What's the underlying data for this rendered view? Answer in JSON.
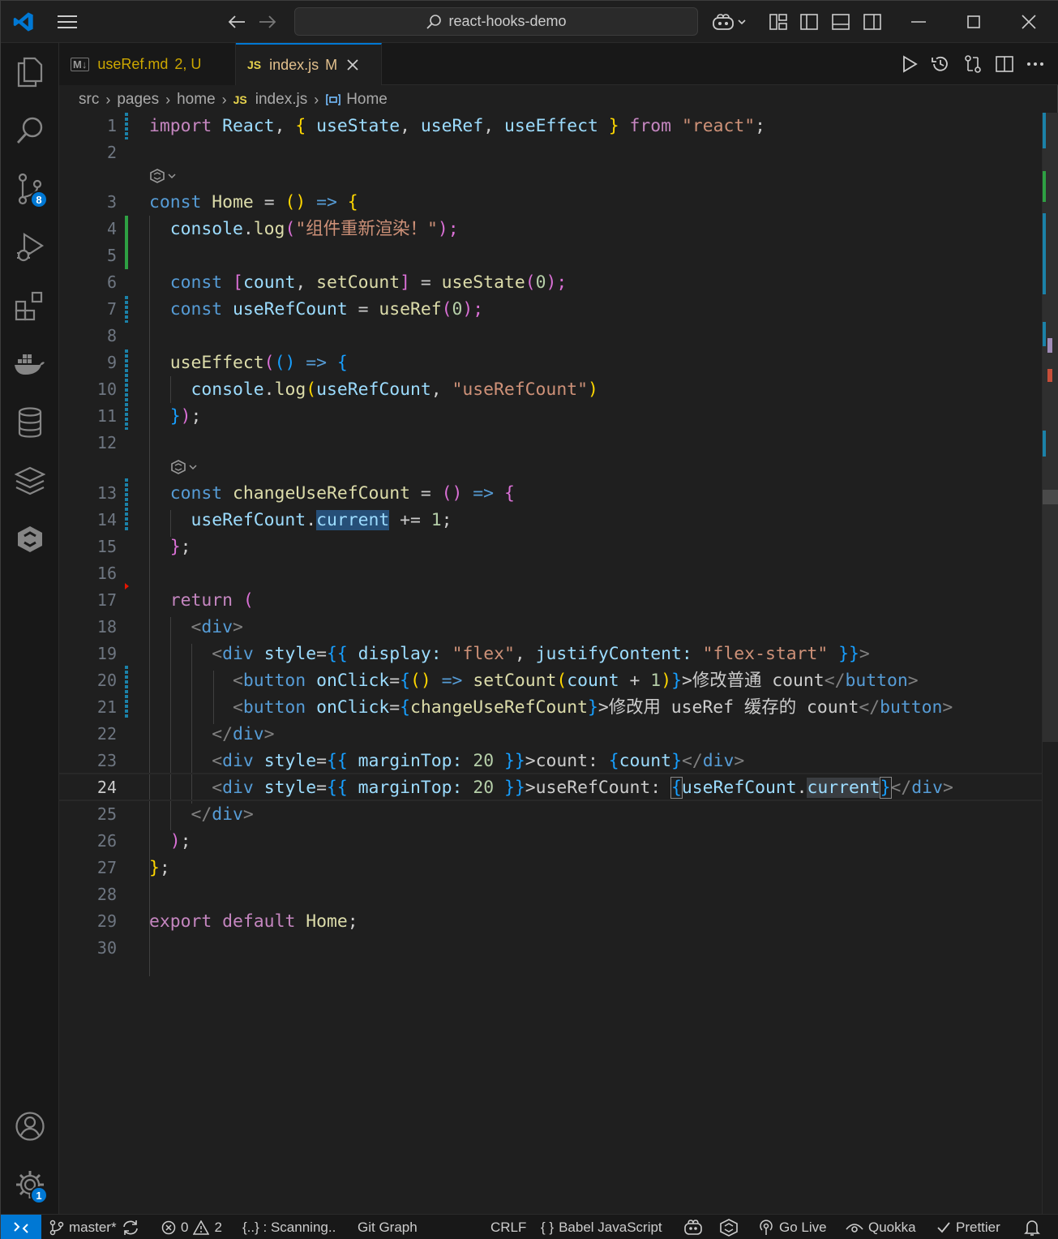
{
  "window": {
    "title": "react-hooks-demo"
  },
  "tabs": [
    {
      "icon": "M↓",
      "name": "useRef.md",
      "status": "2, U"
    },
    {
      "icon": "JS",
      "name": "index.js",
      "status": "M"
    }
  ],
  "breadcrumb": [
    "src",
    "pages",
    "home",
    "index.js",
    "Home"
  ],
  "breadcrumb_icons": {
    "js": "JS"
  },
  "activity": {
    "scm_badge": "8",
    "settings_badge": "1"
  },
  "line_numbers": [
    "1",
    "2",
    "3",
    "4",
    "5",
    "6",
    "7",
    "8",
    "9",
    "10",
    "11",
    "12",
    "13",
    "14",
    "15",
    "16",
    "17",
    "18",
    "19",
    "20",
    "21",
    "22",
    "23",
    "24",
    "25",
    "26",
    "27",
    "28",
    "29",
    "30"
  ],
  "code": {
    "l1": [
      "import",
      " ",
      "React",
      ", ",
      "{",
      " ",
      "useState",
      ", ",
      "useRef",
      ", ",
      "useEffect",
      " ",
      "}",
      " ",
      "from",
      " ",
      "\"react\"",
      ";"
    ],
    "l3": [
      "const",
      " ",
      "Home",
      " = ",
      "()",
      " ",
      "=>",
      " ",
      "{"
    ],
    "l4": [
      "  console",
      ".",
      "log",
      "(",
      "\"组件重新渲染！\"",
      ");"
    ],
    "l6": [
      "  const",
      " ",
      "[",
      "count",
      ", ",
      "setCount",
      "]",
      " = ",
      "useState",
      "(",
      "0",
      ");"
    ],
    "l7": [
      "  const",
      " ",
      "useRefCount",
      " = ",
      "useRef",
      "(",
      "0",
      ");"
    ],
    "l9": [
      "  useEffect",
      "(",
      "()",
      " ",
      "=>",
      " ",
      "{"
    ],
    "l10": [
      "    console",
      ".",
      "log",
      "(",
      "useRefCount",
      ", ",
      "\"useRefCount\"",
      ")"
    ],
    "l11": [
      "  ",
      "}",
      ")",
      ";"
    ],
    "l13": [
      "  const",
      " ",
      "changeUseRefCount",
      " = ",
      "()",
      " ",
      "=>",
      " ",
      "{"
    ],
    "l14": [
      "    useRefCount",
      ".",
      "current",
      " += ",
      "1",
      ";"
    ],
    "l15": [
      "  ",
      "}",
      ";"
    ],
    "l17": [
      "  return",
      " ",
      "("
    ],
    "l18": [
      "    <",
      "div",
      ">"
    ],
    "l19": [
      "      <",
      "div",
      " ",
      "style",
      "=",
      "{{",
      " ",
      "display",
      ": ",
      "\"flex\"",
      ", ",
      "justifyContent",
      ": ",
      "\"flex-start\"",
      " ",
      "}}",
      ">"
    ],
    "l20": [
      "        <",
      "button",
      " ",
      "onClick",
      "=",
      "{",
      "()",
      " ",
      "=>",
      " ",
      "setCount",
      "(",
      "count",
      " + ",
      "1",
      ")",
      "}",
      ">修改普通 count",
      "</",
      "button",
      ">"
    ],
    "l21": [
      "        <",
      "button",
      " ",
      "onClick",
      "=",
      "{",
      "changeUseRefCount",
      "}",
      ">修改用 useRef 缓存的 count",
      "</",
      "button",
      ">"
    ],
    "l22": [
      "      </",
      "div",
      ">"
    ],
    "l23": [
      "      <",
      "div",
      " ",
      "style",
      "=",
      "{{",
      " ",
      "marginTop",
      ": ",
      "20",
      " ",
      "}}",
      ">count: ",
      "{",
      "count",
      "}",
      "</",
      "div",
      ">"
    ],
    "l24": [
      "      <",
      "div",
      " ",
      "style",
      "=",
      "{{",
      " ",
      "marginTop",
      ": ",
      "20",
      " ",
      "}}",
      ">useRefCount: ",
      "{",
      "useRefCount",
      ".",
      "current",
      "}",
      "</",
      "div",
      ">"
    ],
    "l25": [
      "    </",
      "div",
      ">"
    ],
    "l26": [
      "  ",
      ")",
      ";"
    ],
    "l27": [
      "}",
      ";"
    ],
    "l29": [
      "export",
      " ",
      "default",
      " ",
      "Home",
      ";"
    ]
  },
  "status": {
    "branch": "master*",
    "errors": "0",
    "warnings": "2",
    "scanning": "{..} : Scanning..",
    "git_graph": "Git Graph",
    "eol": "CRLF",
    "braces": "{ }",
    "language": "Babel JavaScript",
    "go_live": "Go Live",
    "quokka": "Quokka",
    "prettier": "Prettier"
  },
  "colors": {
    "accent": "#0078d4",
    "background": "#1f1f1f",
    "activitybar": "#181818"
  }
}
